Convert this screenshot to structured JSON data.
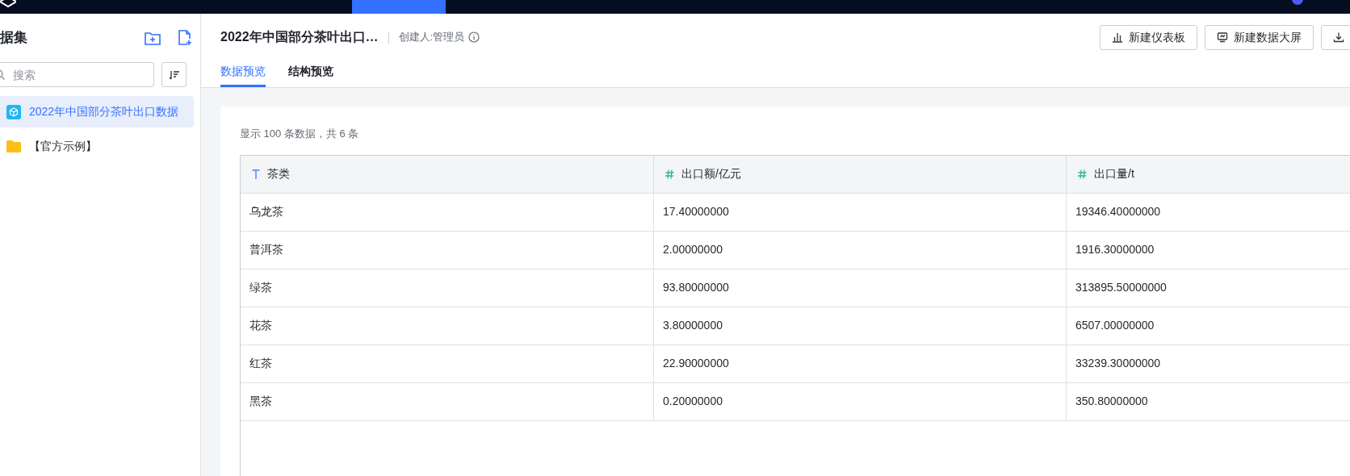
{
  "sidebar": {
    "title": "据集",
    "search": {
      "placeholder": "搜索"
    },
    "items": [
      {
        "label": "2022年中国部分茶叶出口数据",
        "kind": "dataset",
        "selected": true
      },
      {
        "label": "【官方示例】",
        "kind": "folder",
        "selected": false
      }
    ]
  },
  "header": {
    "title": "2022年中国部分茶叶出口…",
    "creator": "创建人:管理员",
    "buttons": [
      {
        "label": "新建仪表板",
        "kind": "chart"
      },
      {
        "label": "新建数据大屏",
        "kind": "screen"
      },
      {
        "kind": "download"
      }
    ],
    "tabs": [
      {
        "label": "数据预览",
        "selected": true
      },
      {
        "label": "结构预览",
        "selected": false
      }
    ]
  },
  "summary": "显示 100 条数据，共 6 条",
  "table": {
    "columns": [
      {
        "label": "茶类",
        "kind": "text"
      },
      {
        "label": "出口额/亿元",
        "kind": "number"
      },
      {
        "label": "出口量/t",
        "kind": "number"
      }
    ],
    "rows": [
      [
        "乌龙茶",
        "17.40000000",
        "19346.40000000"
      ],
      [
        "普洱茶",
        "2.00000000",
        "1916.30000000"
      ],
      [
        "绿茶",
        "93.80000000",
        "313895.50000000"
      ],
      [
        "花茶",
        "3.80000000",
        "6507.00000000"
      ],
      [
        "红茶",
        "22.90000000",
        "33239.30000000"
      ],
      [
        "黑茶",
        "0.20000000",
        "350.80000000"
      ]
    ]
  }
}
